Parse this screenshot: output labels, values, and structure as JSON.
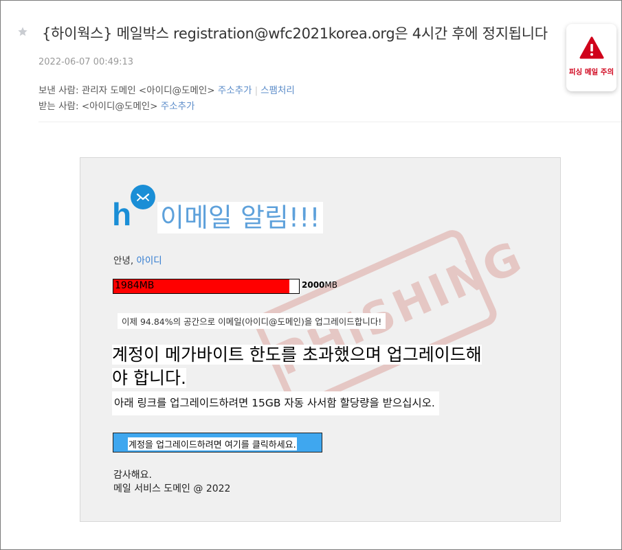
{
  "email": {
    "subject": "{하이웍스} 메일박스 registration@wfc2021korea.org은 4시간 후에 정지됩니다",
    "date": "2022-06-07 00:49:13",
    "from_label": "보낸 사람:",
    "from_value": "관리자 도메인 <아이디@도메인>",
    "to_label": "받는 사람:",
    "to_value": "<아이디@도메인>",
    "add_address": "주소추가",
    "spam": "스팸처리"
  },
  "phishing_badge": {
    "label": "피싱 메일 주의",
    "color": "#d0021b"
  },
  "body": {
    "logo_letter": "h",
    "heading": "이메일 알림!!!",
    "greeting": "안녕,",
    "greeting_name": "아이디",
    "quota_used": "1984MB",
    "quota_max": "2000",
    "quota_max_unit": "MB",
    "quota_ratio": 0.948,
    "notice": "이제 94.84%의 공간으로 이메일(아이디@도메인)을 업그레이드합니다!",
    "warning_line1": "계정이 메가바이트 한도를 초과했으며 업그레이드해",
    "warning_line2": "야 합니다.",
    "instruction": "아래 링크를 업그레이드하려면 15GB 자동 사서함 할당량을 받으십시오.",
    "button": "계정을 업그레이드하려면 여기를 클릭하세요.",
    "thanks": "감사해요.",
    "signature": "메일 서비스 도메인 @ 2022",
    "stamp": "PHISHING"
  },
  "colors": {
    "link": "#5b8cc9",
    "accent": "#1a8ed6",
    "bar_fill": "#ff0000",
    "button": "#3fa7ef"
  }
}
